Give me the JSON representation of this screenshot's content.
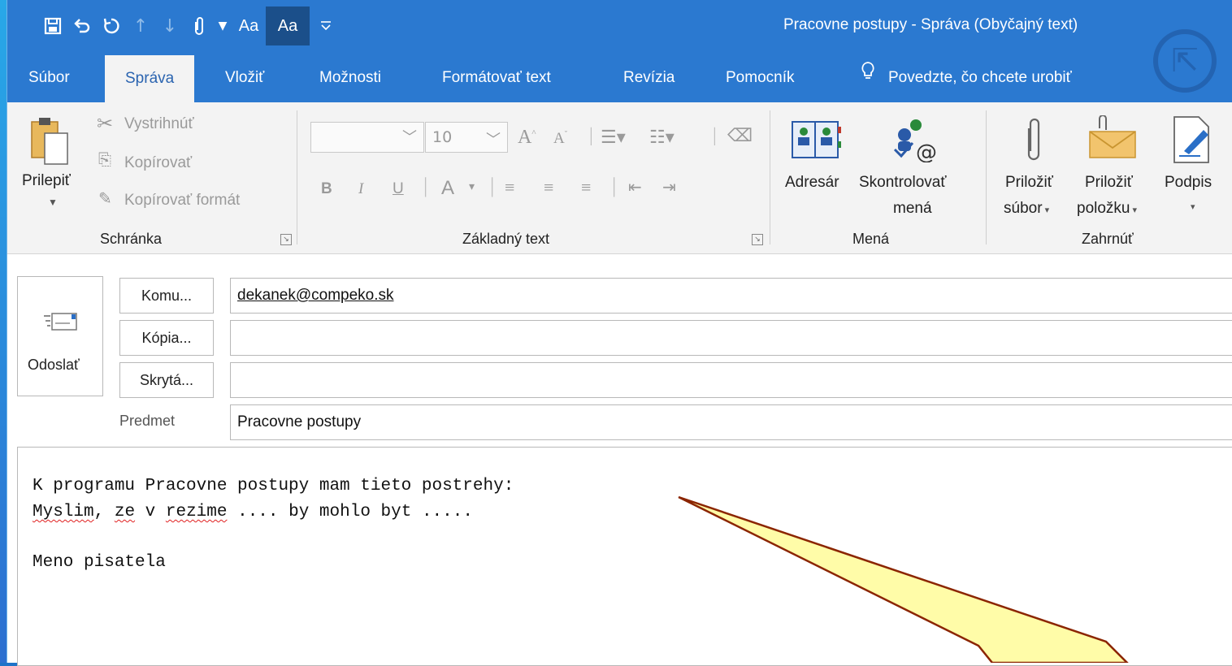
{
  "window": {
    "title": "Pracovne postupy  -  Správa (Obyčajný text)"
  },
  "qat": {
    "aa1": "Aa",
    "aa2": "Aa"
  },
  "tabs": [
    {
      "label": "Súbor"
    },
    {
      "label": "Správa"
    },
    {
      "label": "Vložiť"
    },
    {
      "label": "Možnosti"
    },
    {
      "label": "Formátovať text"
    },
    {
      "label": "Revízia"
    },
    {
      "label": "Pomocník"
    }
  ],
  "tell_me": "Povedzte, čo chcete urobiť",
  "ribbon": {
    "clipboard": {
      "paste": "Prilepiť",
      "cut": "Vystrihnúť",
      "copy": "Kopírovať",
      "format_painter": "Kopírovať formát",
      "group": "Schránka"
    },
    "basic_text": {
      "font_name": "",
      "font_size": "10",
      "bold": "B",
      "italic": "I",
      "underline": "U",
      "font_color": "A",
      "grow": "A",
      "shrink": "A",
      "group": "Základný text"
    },
    "names": {
      "address_book": "Adresár",
      "check_names_1": "Skontrolovať",
      "check_names_2": "mená",
      "group": "Mená"
    },
    "include": {
      "attach_file_1": "Priložiť",
      "attach_file_2": "súbor",
      "attach_item_1": "Priložiť",
      "attach_item_2": "položku",
      "signature": "Podpis",
      "group": "Zahrnúť"
    }
  },
  "compose": {
    "send": "Odoslať",
    "to_button": "Komu...",
    "cc_button": "Kópia...",
    "bcc_button": "Skrytá...",
    "to_value": "dekanek@compeko.sk",
    "cc_value": "",
    "bcc_value": "",
    "subject_label": "Predmet",
    "subject_value": "Pracovne postupy",
    "body": {
      "line1": "K programu Pracovne postupy mam tieto postrehy:",
      "line2_w1": "Myslim",
      "line2_a": ", ",
      "line2_w2": "ze",
      "line2_b": " v ",
      "line2_w3": "rezime",
      "line2_c": " .... by mohlo byt .....",
      "line4": "Meno pisatela"
    }
  },
  "colors": {
    "titlebar": "#2b79d0",
    "ribbon": "#f3f3f3",
    "callout": "#fffca8",
    "callout_border": "#8b2500"
  }
}
